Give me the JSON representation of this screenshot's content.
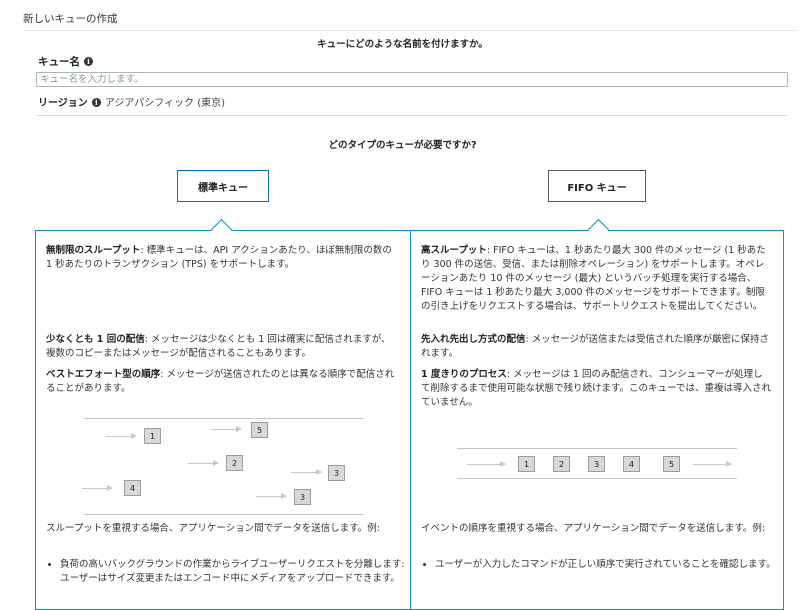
{
  "page": {
    "title": "新しいキューの作成"
  },
  "name_section": {
    "question": "キューにどのような名前を付けますか。",
    "label": "キュー名",
    "placeholder": "キュー名を入力します。",
    "info_icon": "info-icon"
  },
  "region": {
    "label": "リージョン",
    "value": "アジアパシフィック (東京)",
    "info_icon": "info-icon"
  },
  "type_section": {
    "question": "どのタイプのキューが必要ですか?",
    "standard_button": "標準キュー",
    "fifo_button": "FIFO キュー",
    "selected": "standard"
  },
  "standard": {
    "throughput_title": "無制限のスループット",
    "throughput_text": ": 標準キューは、API アクションあたり、ほぼ無制限の数の 1 秒あたりのトランザクション (TPS) をサポートします。",
    "delivery_title": "少なくとも 1 回の配信",
    "delivery_text": ": メッセージは少なくとも 1 回は確実に配信されますが、複数のコピーまたはメッセージが配信されることもあります。",
    "order_title": "ベストエフォート型の順序",
    "order_text": ": メッセージが送信されたのとは異なる順序で配信されることがあります。",
    "diagram_labels": [
      "1",
      "5",
      "2",
      "3",
      "4",
      "3"
    ],
    "use_case_intro": "スループットを重視する場合、アプリケーション間でデータを送信します。例:",
    "bullets": [
      "負荷の高いバックグラウンドの作業からライブユーザーリクエストを分離します: ユーザーはサイズ変更またはエンコード中にメディアをアップロードできます。"
    ]
  },
  "fifo": {
    "throughput_title": "高スループット",
    "throughput_text": ": FIFO キューは、1 秒あたり最大 300 件のメッセージ (1 秒あたり 300 件の送信、受信、または削除オペレーション) をサポートします。オペレーションあたり 10 件のメッセージ (最大) というバッチ処理を実行する場合、FIFO キューは 1 秒あたり最大 3,000 件のメッセージをサポートできます。制限の引き上げをリクエストする場合は、サポートリクエストを提出してください。",
    "order_title": "先入れ先出し方式の配信",
    "order_text": ": メッセージが送信または受信された順序が厳密に保持されます。",
    "once_title": "1 度きりのプロセス",
    "once_text": ": メッセージは 1 回のみ配信され、コンシューマーが処理して削除するまで使用可能な状態で残り続けます。このキューでは、重複は導入されていません。",
    "diagram_labels": [
      "1",
      "2",
      "3",
      "4",
      "5"
    ],
    "use_case_intro": "イベントの順序を重視する場合、アプリケーション間でデータを送信します。例:",
    "bullets": [
      "ユーザーが入力したコマンドが正しい順序で実行されていることを確認します。"
    ]
  },
  "colors": {
    "accent": "#0a8fc6",
    "selected_border": "#0073bb",
    "message_box": "#d8d8d8"
  }
}
